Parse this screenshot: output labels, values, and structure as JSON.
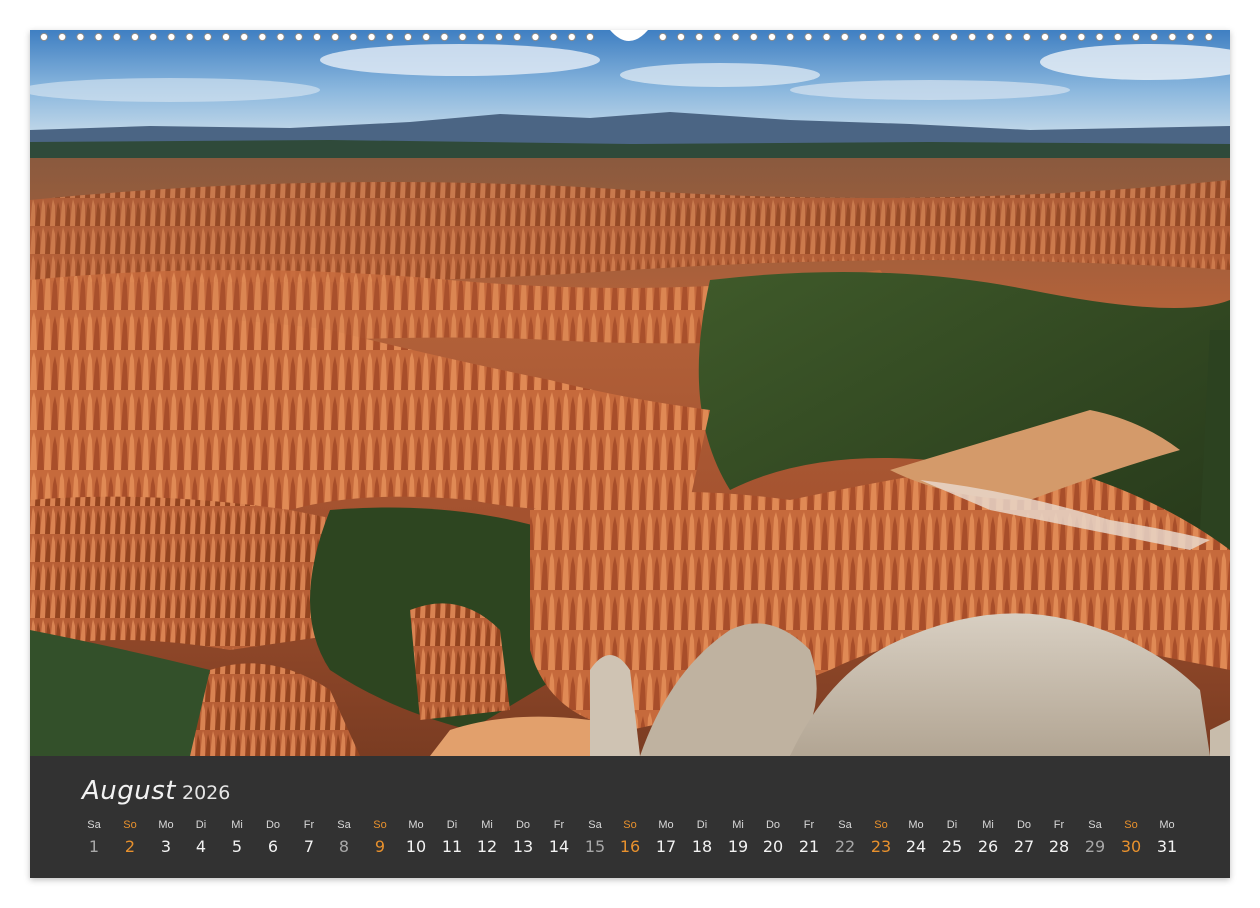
{
  "calendar": {
    "month": "August",
    "year": "2026",
    "accent_color": "#e8912d",
    "days": [
      {
        "dow": "Sa",
        "num": "1",
        "type": "sat"
      },
      {
        "dow": "So",
        "num": "2",
        "type": "sun"
      },
      {
        "dow": "Mo",
        "num": "3",
        "type": "wk"
      },
      {
        "dow": "Di",
        "num": "4",
        "type": "wk"
      },
      {
        "dow": "Mi",
        "num": "5",
        "type": "wk"
      },
      {
        "dow": "Do",
        "num": "6",
        "type": "wk"
      },
      {
        "dow": "Fr",
        "num": "7",
        "type": "wk"
      },
      {
        "dow": "Sa",
        "num": "8",
        "type": "sat"
      },
      {
        "dow": "So",
        "num": "9",
        "type": "sun"
      },
      {
        "dow": "Mo",
        "num": "10",
        "type": "wk"
      },
      {
        "dow": "Di",
        "num": "11",
        "type": "wk"
      },
      {
        "dow": "Mi",
        "num": "12",
        "type": "wk"
      },
      {
        "dow": "Do",
        "num": "13",
        "type": "wk"
      },
      {
        "dow": "Fr",
        "num": "14",
        "type": "wk"
      },
      {
        "dow": "Sa",
        "num": "15",
        "type": "sat"
      },
      {
        "dow": "So",
        "num": "16",
        "type": "sun"
      },
      {
        "dow": "Mo",
        "num": "17",
        "type": "wk"
      },
      {
        "dow": "Di",
        "num": "18",
        "type": "wk"
      },
      {
        "dow": "Mi",
        "num": "19",
        "type": "wk"
      },
      {
        "dow": "Do",
        "num": "20",
        "type": "wk"
      },
      {
        "dow": "Fr",
        "num": "21",
        "type": "wk"
      },
      {
        "dow": "Sa",
        "num": "22",
        "type": "sat"
      },
      {
        "dow": "So",
        "num": "23",
        "type": "sun"
      },
      {
        "dow": "Mo",
        "num": "24",
        "type": "wk"
      },
      {
        "dow": "Di",
        "num": "25",
        "type": "wk"
      },
      {
        "dow": "Mi",
        "num": "26",
        "type": "wk"
      },
      {
        "dow": "Do",
        "num": "27",
        "type": "wk"
      },
      {
        "dow": "Fr",
        "num": "28",
        "type": "wk"
      },
      {
        "dow": "Sa",
        "num": "29",
        "type": "sat"
      },
      {
        "dow": "So",
        "num": "30",
        "type": "sun"
      },
      {
        "dow": "Mo",
        "num": "31",
        "type": "wk"
      }
    ]
  }
}
